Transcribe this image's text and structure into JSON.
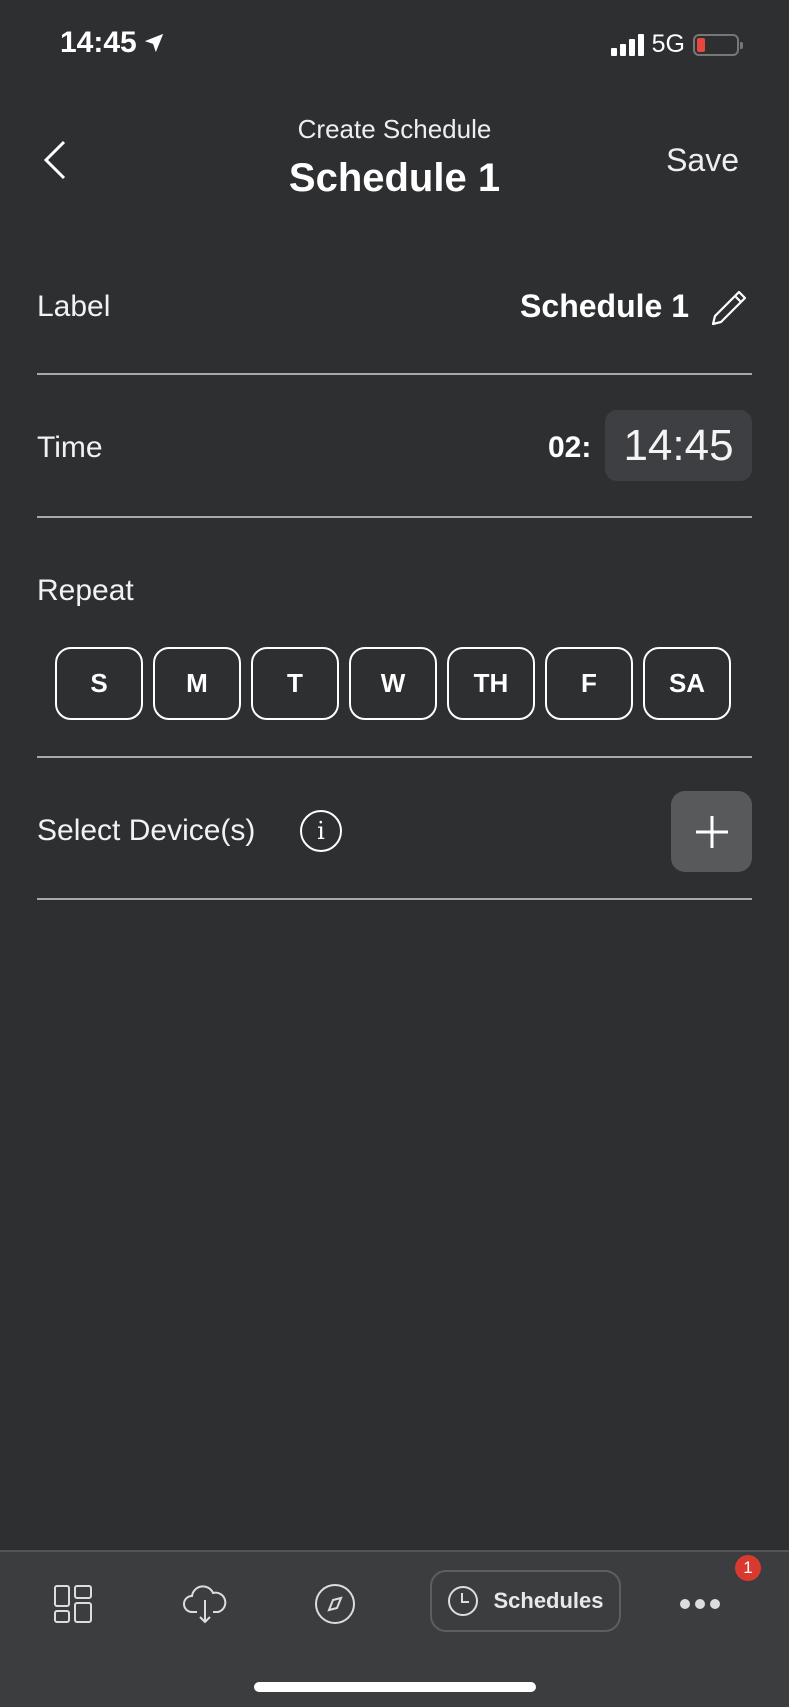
{
  "status_bar": {
    "time": "14:45",
    "network": "5G",
    "location_icon": "location-arrow-icon",
    "battery_color": "#e5483c"
  },
  "header": {
    "subtitle": "Create Schedule",
    "title": "Schedule 1",
    "save_label": "Save"
  },
  "form": {
    "label": {
      "title": "Label",
      "value": "Schedule 1"
    },
    "time": {
      "title": "Time",
      "partial_value": "02:",
      "value": "14:45"
    },
    "repeat": {
      "title": "Repeat",
      "days": [
        "S",
        "M",
        "T",
        "W",
        "TH",
        "F",
        "SA"
      ]
    },
    "devices": {
      "title": "Select Device(s)",
      "info_glyph": "i"
    }
  },
  "tab_bar": {
    "items": [
      {
        "icon": "dashboard-icon"
      },
      {
        "icon": "cloud-download-icon"
      },
      {
        "icon": "compass-icon"
      },
      {
        "icon": "clock-icon",
        "label": "Schedules",
        "active": true
      },
      {
        "icon": "more-icon"
      }
    ],
    "badge": "1",
    "badge_color": "#d83a30"
  }
}
